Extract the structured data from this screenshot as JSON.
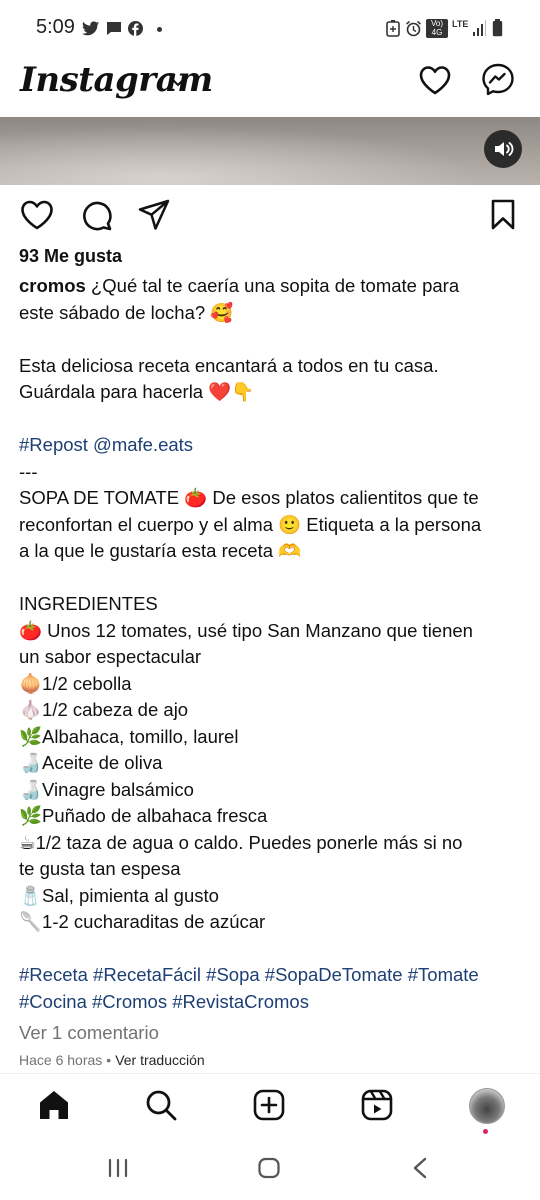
{
  "status": {
    "time": "5:09",
    "right": [
      "Vo) 4G",
      "LTE"
    ]
  },
  "header": {
    "logo": "Instagram"
  },
  "post": {
    "likes": "93 Me gusta",
    "username": "cromos",
    "lines": [
      " ¿Qué tal te caería una sopita de tomate para",
      "este sábado de locha? 🥰",
      "",
      "Esta deliciosa receta encantará a todos en tu casa.",
      "Guárdala para hacerla ❤️👇",
      "",
      "#Repost @mafe.eats",
      "---",
      "SOPA DE TOMATE 🍅 De esos platos calientitos que te",
      "reconfortan el cuerpo y el alma 🙂 Etiqueta a la persona",
      "a la que le gustaría esta receta 🫶",
      "",
      "INGREDIENTES",
      "🍅 Unos 12 tomates, usé tipo San Manzano que tienen",
      "un sabor espectacular",
      "🧅1/2 cebolla",
      "🧄1/2 cabeza de ajo",
      "🌿Albahaca, tomillo, laurel",
      "🍶Aceite de oliva",
      "🍶Vinagre balsámico",
      "🌿Puñado de albahaca fresca",
      "☕1/2 taza de agua o caldo. Puedes ponerle más si no",
      "te gusta tan espesa",
      "🧂Sal, pimienta al gusto",
      "🥄1-2 cucharaditas de azúcar",
      "",
      "#Receta #RecetaFácil #Sopa #SopaDeTomate #Tomate",
      "#Cocina #Cromos #RevistaCromos"
    ],
    "comments_link": "Ver 1 comentario",
    "time_ago": "Hace 6 horas",
    "translate": "Ver traducción"
  },
  "icons": {
    "header": [
      "heart-icon",
      "messenger-icon"
    ],
    "actions": [
      "like-icon",
      "comment-icon",
      "share-icon",
      "save-icon"
    ],
    "nav": [
      "home-icon",
      "search-icon",
      "create-icon",
      "reels-icon",
      "profile-avatar"
    ]
  },
  "colors": {
    "hashtag": "#1d3f74",
    "muted": "#737373",
    "notification_dot": "#e0245e"
  }
}
